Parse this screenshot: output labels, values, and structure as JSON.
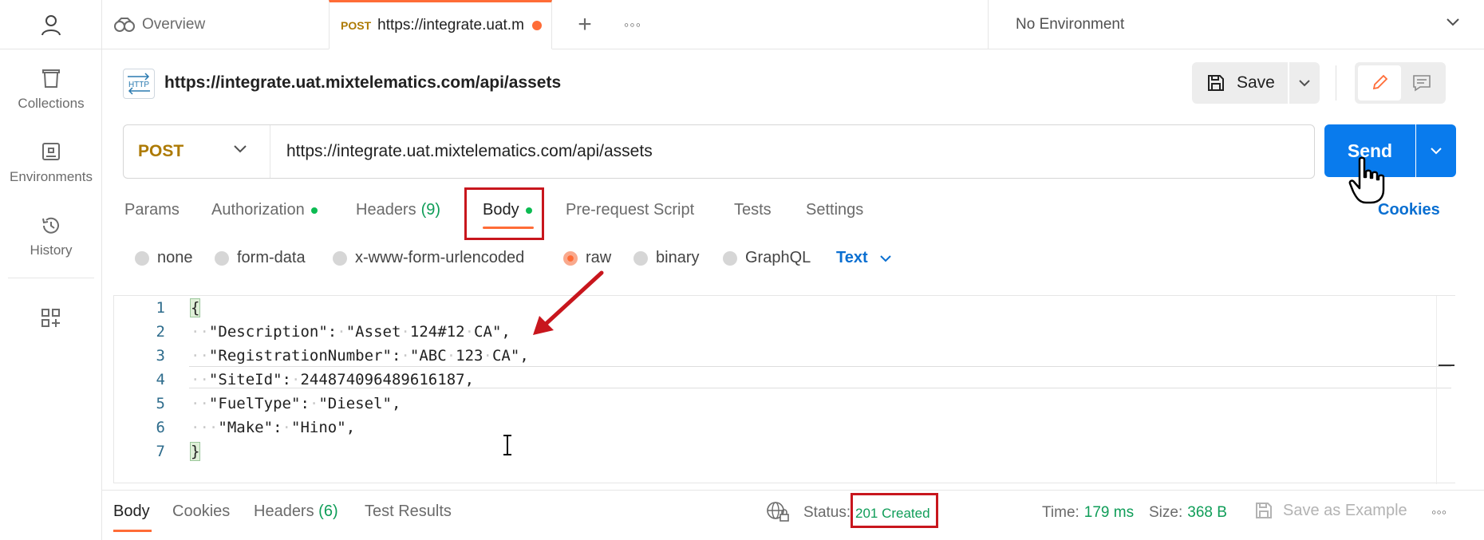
{
  "sidebar": {
    "items": [
      {
        "label": "Collections",
        "icon": "trash-can-icon"
      },
      {
        "label": "Environments",
        "icon": "environment-icon"
      },
      {
        "label": "History",
        "icon": "history-icon"
      }
    ]
  },
  "tabs": {
    "overview_label": "Overview",
    "active_method": "POST",
    "active_url": "https://integrate.uat.mixtelematics.com/api/assets",
    "plus": "+",
    "more": "◦◦◦"
  },
  "environment": {
    "label": "No Environment"
  },
  "request": {
    "icon_text": "HTTP",
    "title": "https://integrate.uat.mixtelematics.com/api/assets",
    "save_label": "Save",
    "method": "POST",
    "url": "https://integrate.uat.mixtelematics.com/api/assets",
    "send_label": "Send",
    "cookies_label": "Cookies"
  },
  "request_tabs": [
    {
      "label": "Params"
    },
    {
      "label": "Authorization"
    },
    {
      "label": "Headers",
      "count": "(9)"
    },
    {
      "label": "Body"
    },
    {
      "label": "Pre-request Script"
    },
    {
      "label": "Tests"
    },
    {
      "label": "Settings"
    }
  ],
  "body_types": [
    {
      "label": "none"
    },
    {
      "label": "form-data"
    },
    {
      "label": "x-www-form-urlencoded"
    },
    {
      "label": "raw",
      "selected": true
    },
    {
      "label": "binary"
    },
    {
      "label": "GraphQL"
    }
  ],
  "body_format": "Text",
  "editor": {
    "lines": [
      {
        "n": "1",
        "text": "{"
      },
      {
        "n": "2",
        "text": "  \"Description\": \"Asset 124#12 CA\","
      },
      {
        "n": "3",
        "text": "  \"RegistrationNumber\": \"ABC 123 CA\","
      },
      {
        "n": "4",
        "text": "  \"SiteId\": 244874096489616187,"
      },
      {
        "n": "5",
        "text": "  \"FuelType\": \"Diesel\","
      },
      {
        "n": "6",
        "text": "   \"Make\": \"Hino\","
      },
      {
        "n": "7",
        "text": "}"
      }
    ]
  },
  "response": {
    "tabs": [
      {
        "label": "Body"
      },
      {
        "label": "Cookies"
      },
      {
        "label": "Headers",
        "count": "(6)"
      },
      {
        "label": "Test Results"
      }
    ],
    "status_label": "Status:",
    "status_value": "201 Created",
    "time_label": "Time:",
    "time_value": "179 ms",
    "size_label": "Size:",
    "size_value": "368 B",
    "save_example_label": "Save as Example",
    "more": "◦◦◦"
  },
  "colors": {
    "accent": "#ff6c37",
    "send": "#097bed",
    "method": "#ad7a03",
    "success": "#0f9d58",
    "annotation": "#c8161d"
  }
}
